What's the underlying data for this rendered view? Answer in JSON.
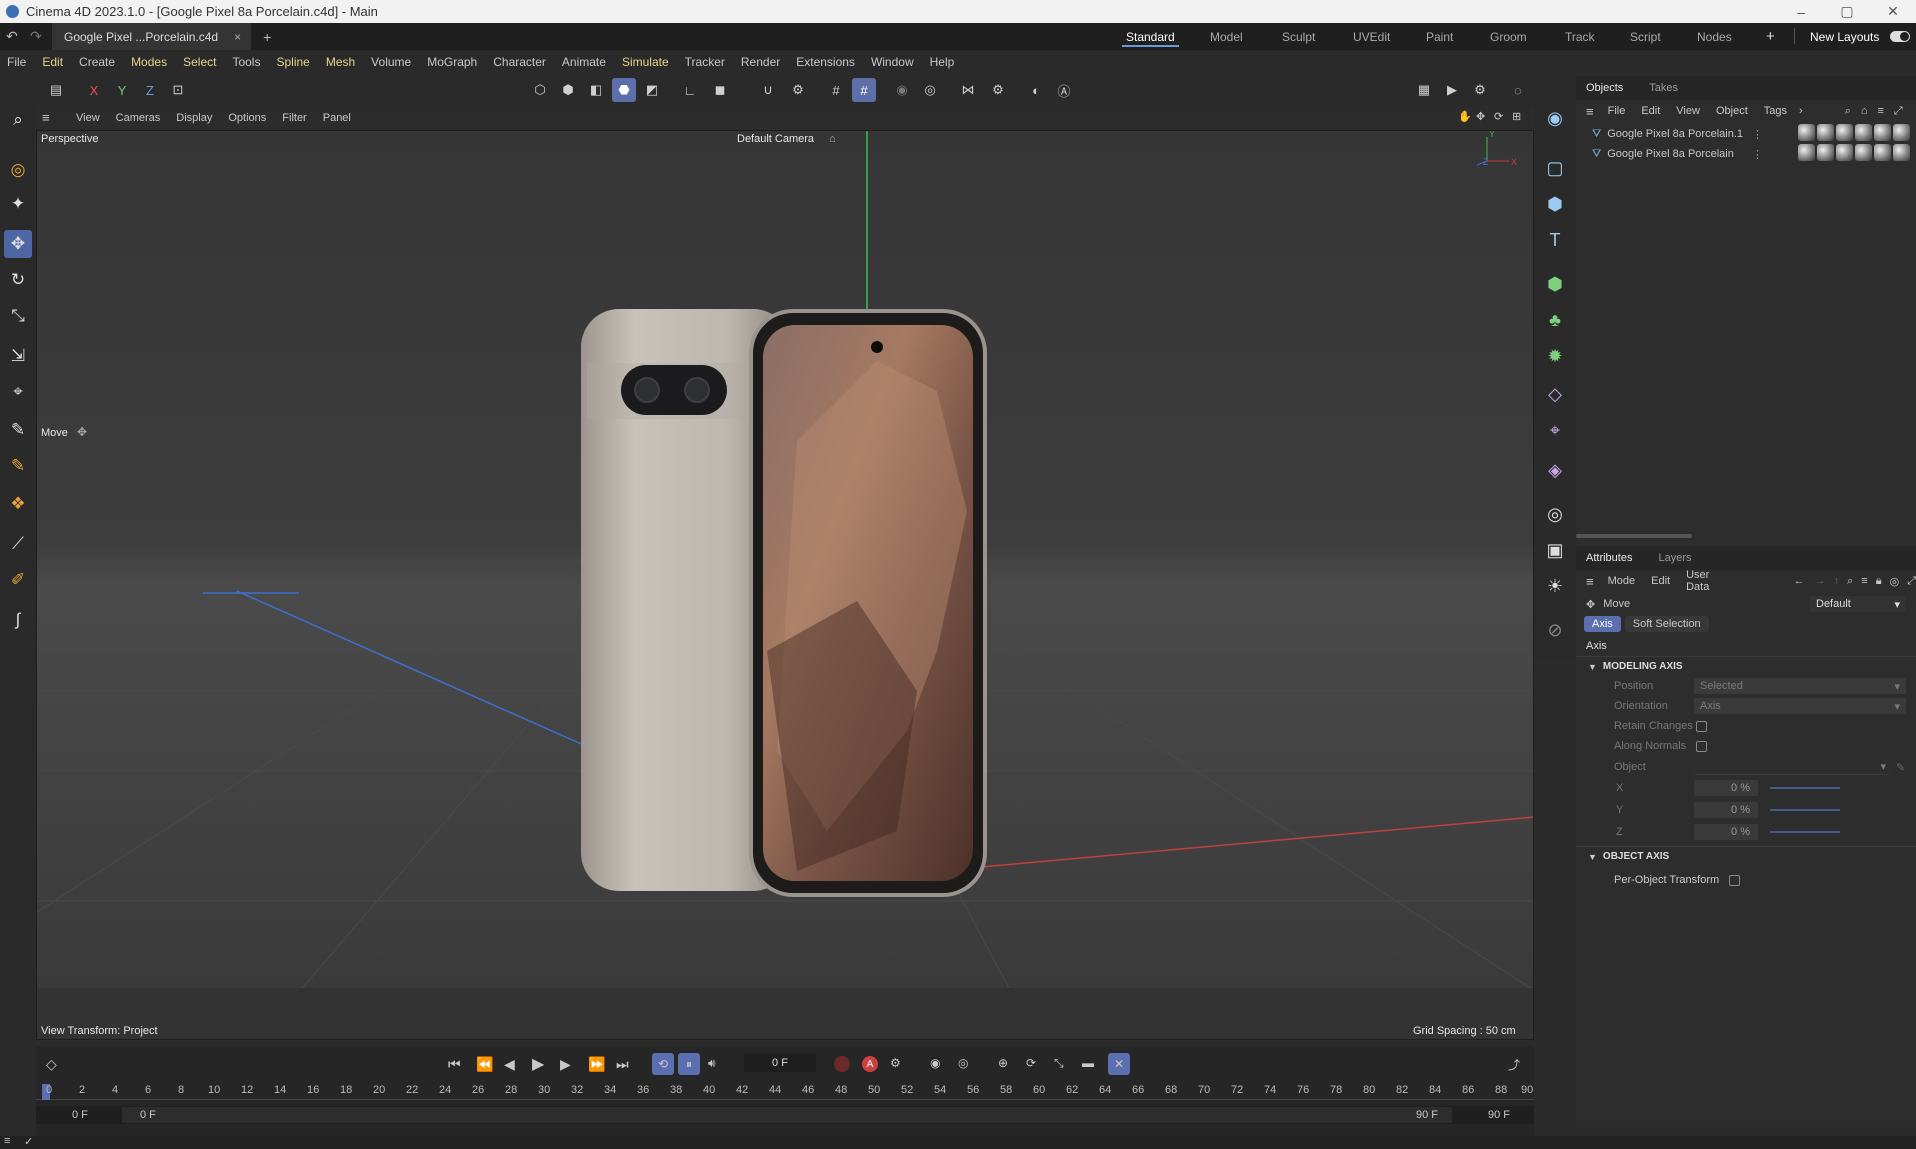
{
  "window": {
    "title": "Cinema 4D 2023.1.0 - [Google Pixel 8a Porcelain.c4d] - Main"
  },
  "document_tab": {
    "label": "Google Pixel ...Porcelain.c4d",
    "close": "×",
    "add": "+"
  },
  "layouts": {
    "tabs": [
      "Standard",
      "Model",
      "Sculpt",
      "UVEdit",
      "Paint",
      "Groom",
      "Track",
      "Script",
      "Nodes"
    ],
    "active": "Standard",
    "add": "+",
    "new_layouts": "New Layouts"
  },
  "menu": [
    "File",
    "Edit",
    "Create",
    "Modes",
    "Select",
    "Tools",
    "Spline",
    "Mesh",
    "Volume",
    "MoGraph",
    "Character",
    "Animate",
    "Simulate",
    "Tracker",
    "Render",
    "Extensions",
    "Window",
    "Help"
  ],
  "axis_buttons": [
    "X",
    "Y",
    "Z"
  ],
  "viewport": {
    "menu": [
      "View",
      "Cameras",
      "Display",
      "Options",
      "Filter",
      "Panel"
    ],
    "mode_label": "Perspective",
    "camera_label": "Default Camera",
    "tool_label": "Move",
    "view_transform": "View Transform: Project",
    "grid_spacing": "Grid Spacing : 50 cm",
    "axis_letters": {
      "y": "Y",
      "z": "Z",
      "x": "X"
    },
    "colors": {
      "bg": "#3a3a3a",
      "x_axis": "#c0403f",
      "y_axis": "#3dbd4b",
      "z_axis": "#3d6fd0"
    }
  },
  "objects_panel": {
    "tabs": [
      "Objects",
      "Takes"
    ],
    "menu": [
      "File",
      "Edit",
      "View",
      "Object",
      "Tags"
    ],
    "items": [
      "Google Pixel 8a Porcelain.1",
      "Google Pixel 8a Porcelain"
    ]
  },
  "attributes_panel": {
    "tabs": [
      "Attributes",
      "Layers"
    ],
    "menu": [
      "Mode",
      "Edit",
      "User Data"
    ],
    "tool_name": "Move",
    "preset": "Default",
    "subtabs": [
      "Axis",
      "Soft Selection"
    ],
    "section_title": "Axis",
    "modeling_axis": {
      "header": "MODELING AXIS",
      "position_label": "Position",
      "position_value": "Selected",
      "orientation_label": "Orientation",
      "orientation_value": "Axis",
      "retain_changes": "Retain Changes",
      "along_normals": "Along Normals",
      "object_label": "Object",
      "x_label": "X",
      "x_value": "0 %",
      "y_label": "Y",
      "y_value": "0 %",
      "z_label": "Z",
      "z_value": "0 %"
    },
    "object_axis": {
      "header": "OBJECT AXIS",
      "per_object": "Per-Object Transform"
    }
  },
  "timeline": {
    "current_frame": "0 F",
    "ticks": [
      "0",
      "2",
      "4",
      "6",
      "8",
      "10",
      "12",
      "14",
      "16",
      "18",
      "20",
      "22",
      "24",
      "26",
      "28",
      "30",
      "32",
      "34",
      "36",
      "38",
      "40",
      "42",
      "44",
      "46",
      "48",
      "50",
      "52",
      "54",
      "56",
      "58",
      "60",
      "62",
      "64",
      "66",
      "68",
      "70",
      "72",
      "74",
      "76",
      "78",
      "80",
      "82",
      "84",
      "86",
      "88",
      "90"
    ],
    "start": "0 F",
    "range_start": "0 F",
    "range_end": "90 F",
    "end": "90 F",
    "record_label": "A"
  }
}
